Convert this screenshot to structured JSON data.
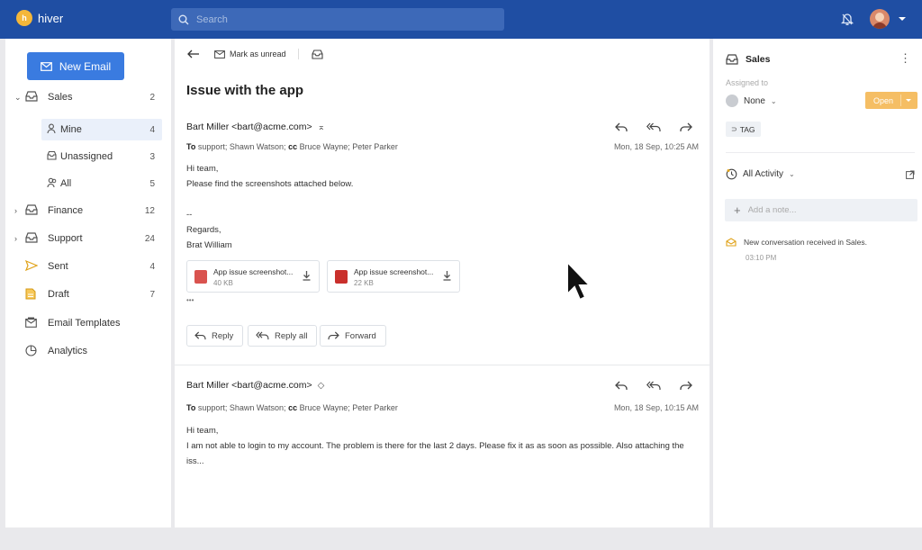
{
  "app": {
    "logo_text": "hiver",
    "logo_glyph": "h"
  },
  "search": {
    "placeholder": "Search"
  },
  "sidebar": {
    "new_email_label": "New Email",
    "items": [
      {
        "label": "Sales",
        "count": "2"
      },
      {
        "label": "Mine",
        "count": "4"
      },
      {
        "label": "Unassigned",
        "count": "3"
      },
      {
        "label": "All",
        "count": "5"
      },
      {
        "label": "Finance",
        "count": "12"
      },
      {
        "label": "Support",
        "count": "24"
      },
      {
        "label": "Sent",
        "count": "4"
      },
      {
        "label": "Draft",
        "count": "7"
      },
      {
        "label": "Email Templates",
        "count": ""
      },
      {
        "label": "Analytics",
        "count": ""
      }
    ]
  },
  "toolbar": {
    "mark_unread": "Mark as unread"
  },
  "email": {
    "subject": "Issue with the app",
    "messages": [
      {
        "from": "Bart Miller <bart@acme.com>",
        "to_label": "To",
        "to": "support; Shawn Watson;",
        "cc_label": "cc",
        "cc": "Bruce Wayne; Peter Parker",
        "date": "Mon, 18 Sep, 10:25 AM",
        "body": [
          "Hi team,",
          "Please find the screenshots attached below.",
          "--",
          "Regards,",
          "Brat William"
        ],
        "attachments": [
          {
            "name": "App issue screenshot...",
            "size": "40 KB"
          },
          {
            "name": "App issue screenshot...",
            "size": "22 KB"
          }
        ],
        "ellipsis": "•••"
      },
      {
        "from": "Bart Miller <bart@acme.com>",
        "to_label": "To",
        "to": "support; Shawn Watson;",
        "cc_label": "cc",
        "cc": "Bruce Wayne; Peter Parker",
        "date": "Mon, 18 Sep, 10:15 AM",
        "body": [
          "Hi team,",
          "I am not able to login to my account. The problem is there for the last 2 days. Please fix it as as soon as possible. Also attaching the",
          "iss..."
        ]
      }
    ],
    "reply_buttons": {
      "reply": "Reply",
      "reply_all": "Reply all",
      "forward": "Forward"
    }
  },
  "right_panel": {
    "inbox": "Sales",
    "assigned_to_label": "Assigned to",
    "assignee": "None",
    "status": "Open",
    "tag": "TAG",
    "activity_filter": "All Activity",
    "note_placeholder": "Add a note...",
    "event_text": "New conversation received in Sales.",
    "event_time": "03:10 PM"
  },
  "colors": {
    "topbar": "#1f4ea3",
    "primary_button": "#3a7be0",
    "status_open": "#f5be64",
    "logo": "#f4b73a"
  }
}
